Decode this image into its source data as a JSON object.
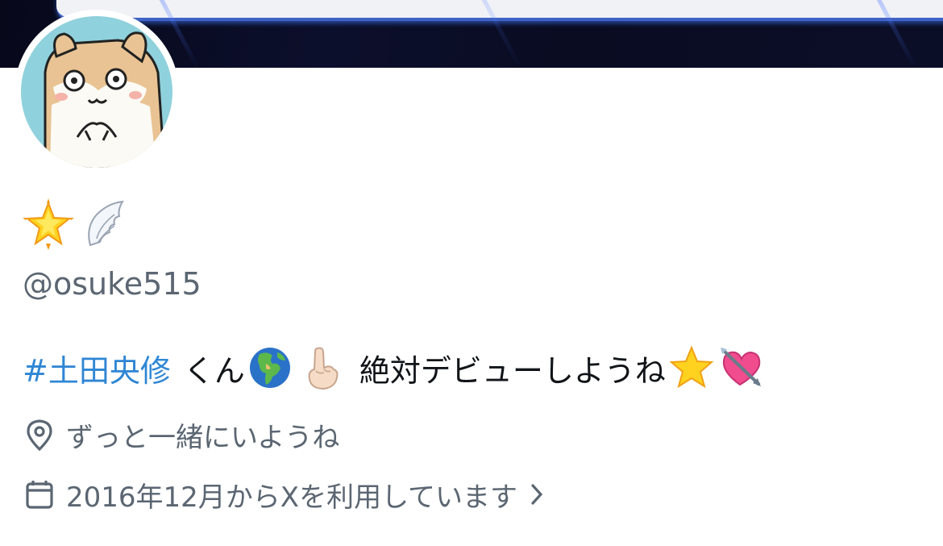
{
  "profile": {
    "display_name_icons": [
      "glowing-star-icon",
      "wing-icon"
    ],
    "handle": "@osuke515",
    "bio": {
      "hashtag": "#土田央修",
      "text_part1": "くん",
      "text_part2": "絶対デビューしようね",
      "emoji_icons": [
        "globe-africa-europe-icon",
        "index-pointing-up-icon",
        "star-icon",
        "heart-with-arrow-icon"
      ]
    },
    "location": {
      "icon": "location-pin-icon",
      "text": "ずっと一緒にいようね"
    },
    "joined": {
      "icon": "calendar-icon",
      "text": "2016年12月からXを利用しています",
      "chevron": "chevron-right-icon"
    }
  },
  "colors": {
    "hashtag": "#2f86d4",
    "secondary_text": "#5b6672",
    "primary_text": "#111418",
    "banner": "#0a0c22",
    "avatar_bg": "#8fd1dc"
  }
}
